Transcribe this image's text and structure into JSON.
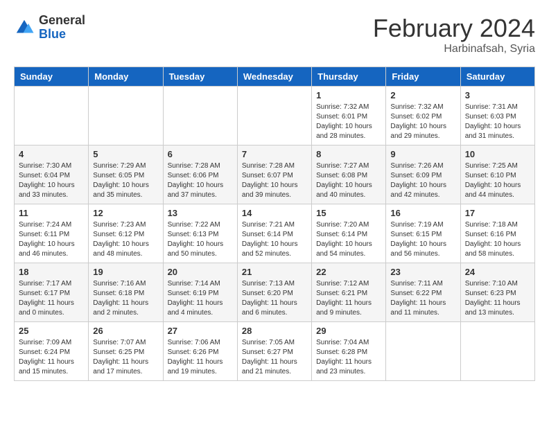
{
  "header": {
    "logo_general": "General",
    "logo_blue": "Blue",
    "title": "February 2024",
    "location": "Harbinafsah, Syria"
  },
  "days_of_week": [
    "Sunday",
    "Monday",
    "Tuesday",
    "Wednesday",
    "Thursday",
    "Friday",
    "Saturday"
  ],
  "weeks": [
    [
      {
        "day": "",
        "info": ""
      },
      {
        "day": "",
        "info": ""
      },
      {
        "day": "",
        "info": ""
      },
      {
        "day": "",
        "info": ""
      },
      {
        "day": "1",
        "info": "Sunrise: 7:32 AM\nSunset: 6:01 PM\nDaylight: 10 hours\nand 28 minutes."
      },
      {
        "day": "2",
        "info": "Sunrise: 7:32 AM\nSunset: 6:02 PM\nDaylight: 10 hours\nand 29 minutes."
      },
      {
        "day": "3",
        "info": "Sunrise: 7:31 AM\nSunset: 6:03 PM\nDaylight: 10 hours\nand 31 minutes."
      }
    ],
    [
      {
        "day": "4",
        "info": "Sunrise: 7:30 AM\nSunset: 6:04 PM\nDaylight: 10 hours\nand 33 minutes."
      },
      {
        "day": "5",
        "info": "Sunrise: 7:29 AM\nSunset: 6:05 PM\nDaylight: 10 hours\nand 35 minutes."
      },
      {
        "day": "6",
        "info": "Sunrise: 7:28 AM\nSunset: 6:06 PM\nDaylight: 10 hours\nand 37 minutes."
      },
      {
        "day": "7",
        "info": "Sunrise: 7:28 AM\nSunset: 6:07 PM\nDaylight: 10 hours\nand 39 minutes."
      },
      {
        "day": "8",
        "info": "Sunrise: 7:27 AM\nSunset: 6:08 PM\nDaylight: 10 hours\nand 40 minutes."
      },
      {
        "day": "9",
        "info": "Sunrise: 7:26 AM\nSunset: 6:09 PM\nDaylight: 10 hours\nand 42 minutes."
      },
      {
        "day": "10",
        "info": "Sunrise: 7:25 AM\nSunset: 6:10 PM\nDaylight: 10 hours\nand 44 minutes."
      }
    ],
    [
      {
        "day": "11",
        "info": "Sunrise: 7:24 AM\nSunset: 6:11 PM\nDaylight: 10 hours\nand 46 minutes."
      },
      {
        "day": "12",
        "info": "Sunrise: 7:23 AM\nSunset: 6:12 PM\nDaylight: 10 hours\nand 48 minutes."
      },
      {
        "day": "13",
        "info": "Sunrise: 7:22 AM\nSunset: 6:13 PM\nDaylight: 10 hours\nand 50 minutes."
      },
      {
        "day": "14",
        "info": "Sunrise: 7:21 AM\nSunset: 6:14 PM\nDaylight: 10 hours\nand 52 minutes."
      },
      {
        "day": "15",
        "info": "Sunrise: 7:20 AM\nSunset: 6:14 PM\nDaylight: 10 hours\nand 54 minutes."
      },
      {
        "day": "16",
        "info": "Sunrise: 7:19 AM\nSunset: 6:15 PM\nDaylight: 10 hours\nand 56 minutes."
      },
      {
        "day": "17",
        "info": "Sunrise: 7:18 AM\nSunset: 6:16 PM\nDaylight: 10 hours\nand 58 minutes."
      }
    ],
    [
      {
        "day": "18",
        "info": "Sunrise: 7:17 AM\nSunset: 6:17 PM\nDaylight: 11 hours\nand 0 minutes."
      },
      {
        "day": "19",
        "info": "Sunrise: 7:16 AM\nSunset: 6:18 PM\nDaylight: 11 hours\nand 2 minutes."
      },
      {
        "day": "20",
        "info": "Sunrise: 7:14 AM\nSunset: 6:19 PM\nDaylight: 11 hours\nand 4 minutes."
      },
      {
        "day": "21",
        "info": "Sunrise: 7:13 AM\nSunset: 6:20 PM\nDaylight: 11 hours\nand 6 minutes."
      },
      {
        "day": "22",
        "info": "Sunrise: 7:12 AM\nSunset: 6:21 PM\nDaylight: 11 hours\nand 9 minutes."
      },
      {
        "day": "23",
        "info": "Sunrise: 7:11 AM\nSunset: 6:22 PM\nDaylight: 11 hours\nand 11 minutes."
      },
      {
        "day": "24",
        "info": "Sunrise: 7:10 AM\nSunset: 6:23 PM\nDaylight: 11 hours\nand 13 minutes."
      }
    ],
    [
      {
        "day": "25",
        "info": "Sunrise: 7:09 AM\nSunset: 6:24 PM\nDaylight: 11 hours\nand 15 minutes."
      },
      {
        "day": "26",
        "info": "Sunrise: 7:07 AM\nSunset: 6:25 PM\nDaylight: 11 hours\nand 17 minutes."
      },
      {
        "day": "27",
        "info": "Sunrise: 7:06 AM\nSunset: 6:26 PM\nDaylight: 11 hours\nand 19 minutes."
      },
      {
        "day": "28",
        "info": "Sunrise: 7:05 AM\nSunset: 6:27 PM\nDaylight: 11 hours\nand 21 minutes."
      },
      {
        "day": "29",
        "info": "Sunrise: 7:04 AM\nSunset: 6:28 PM\nDaylight: 11 hours\nand 23 minutes."
      },
      {
        "day": "",
        "info": ""
      },
      {
        "day": "",
        "info": ""
      }
    ]
  ]
}
